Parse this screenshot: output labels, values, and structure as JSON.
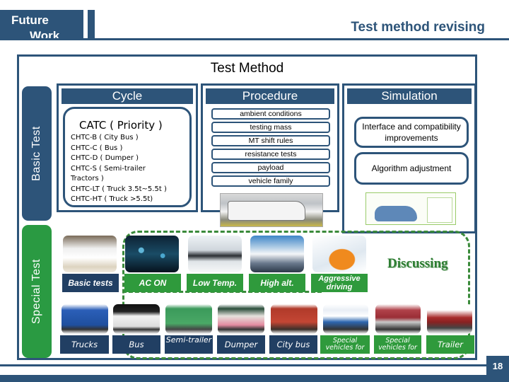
{
  "header": {
    "section_tab": "Future Work",
    "section_tab_line1": "Future",
    "section_tab_line2": "Work",
    "title": "Test method revising"
  },
  "main": {
    "title": "Test Method",
    "side_labels": {
      "basic": "Basic Test",
      "special": "Special Test"
    },
    "cycle": {
      "heading": "Cycle",
      "catc": "CATC ( Priority )",
      "items": [
        "CHTC-B ( City Bus )",
        "CHTC-C ( Bus )",
        "CHTC-D ( Dumper )",
        "CHTC-S ( Semi-trailer",
        "Tractors )",
        "CHTC-LT ( Truck 3.5t~5.5t )",
        "CHTC-HT (  Truck >5.5t)"
      ]
    },
    "procedure": {
      "heading": "Procedure",
      "items": [
        "ambient conditions",
        "testing mass",
        "MT shift rules",
        "resistance tests",
        "payload",
        "vehicle family"
      ]
    },
    "simulation": {
      "heading": "Simulation",
      "items": [
        "Interface and compatibility improvements",
        "Algorithm adjustment"
      ]
    }
  },
  "special": {
    "discussing_label": "Discussing",
    "row1": [
      {
        "label": "Basic tests",
        "style": "blue"
      },
      {
        "label": "AC ON",
        "style": "green"
      },
      {
        "label": "Low Temp.",
        "style": "green"
      },
      {
        "label": "High alt.",
        "style": "green"
      },
      {
        "label": "Aggressive driving",
        "style": "green"
      }
    ],
    "row2": [
      {
        "label": "Trucks",
        "style": "blue"
      },
      {
        "label": "Bus",
        "style": "blue"
      },
      {
        "label": "Semi-trailer",
        "style": "blue"
      },
      {
        "label": "Dumper",
        "style": "blue"
      },
      {
        "label": "City bus",
        "style": "blue"
      },
      {
        "label": "Special vehicles for",
        "style": "green"
      },
      {
        "label": "Special vehicles for",
        "style": "green"
      },
      {
        "label": "Trailer",
        "style": "green"
      }
    ]
  },
  "footer": {
    "page_number": "18"
  },
  "colors": {
    "primary_blue": "#2d5479",
    "dark_blue_label": "#213f63",
    "green": "#2f9a3c",
    "discussing_green": "#2d7d32"
  }
}
